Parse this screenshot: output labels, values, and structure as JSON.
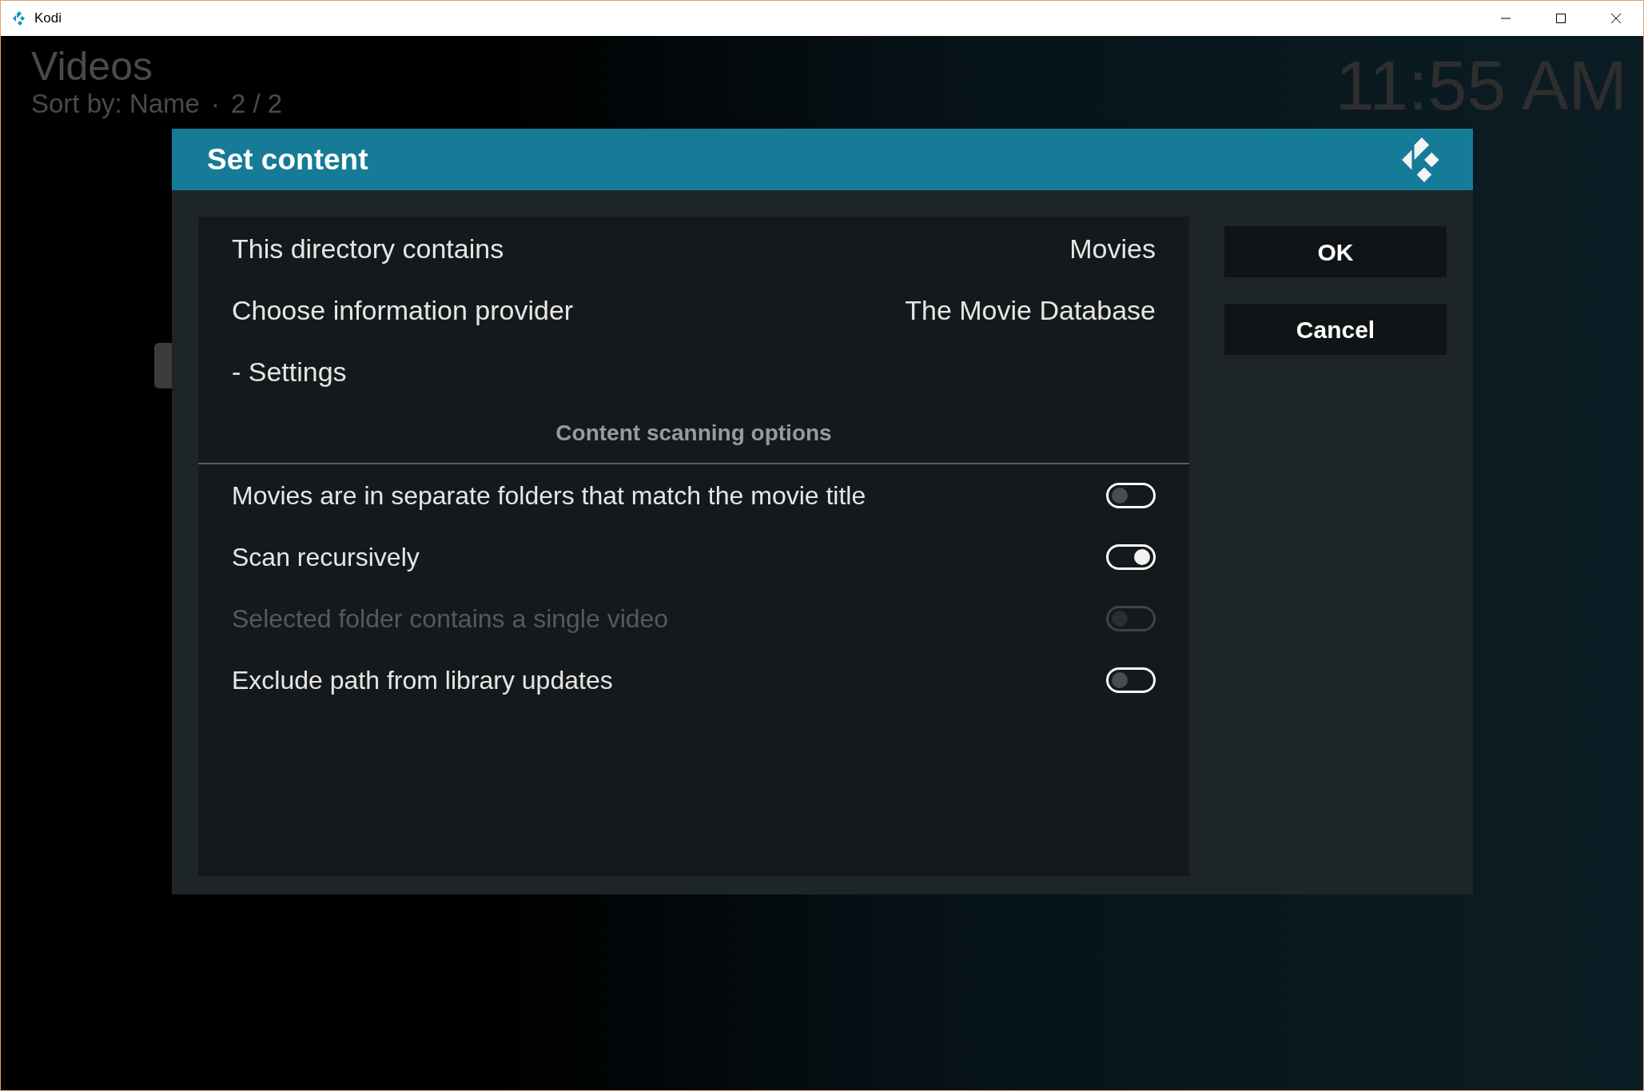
{
  "window": {
    "title": "Kodi"
  },
  "header": {
    "title": "Videos",
    "sort": "Sort by: Name",
    "separator": "·",
    "count": "2 / 2",
    "clock": "11:55 AM"
  },
  "dialog": {
    "title": "Set content",
    "items": [
      {
        "kind": "value",
        "label": "This directory contains",
        "value": "Movies"
      },
      {
        "kind": "value",
        "label": "Choose information provider",
        "value": "The Movie Database"
      },
      {
        "kind": "action",
        "label": "- Settings"
      }
    ],
    "section": "Content scanning options",
    "options": [
      {
        "label": "Movies are in separate folders that match the movie title",
        "on": false,
        "disabled": false
      },
      {
        "label": "Scan recursively",
        "on": true,
        "disabled": false
      },
      {
        "label": "Selected folder contains a single video",
        "on": false,
        "disabled": true
      },
      {
        "label": "Exclude path from library updates",
        "on": false,
        "disabled": false
      }
    ],
    "buttons": [
      "OK",
      "Cancel"
    ]
  }
}
